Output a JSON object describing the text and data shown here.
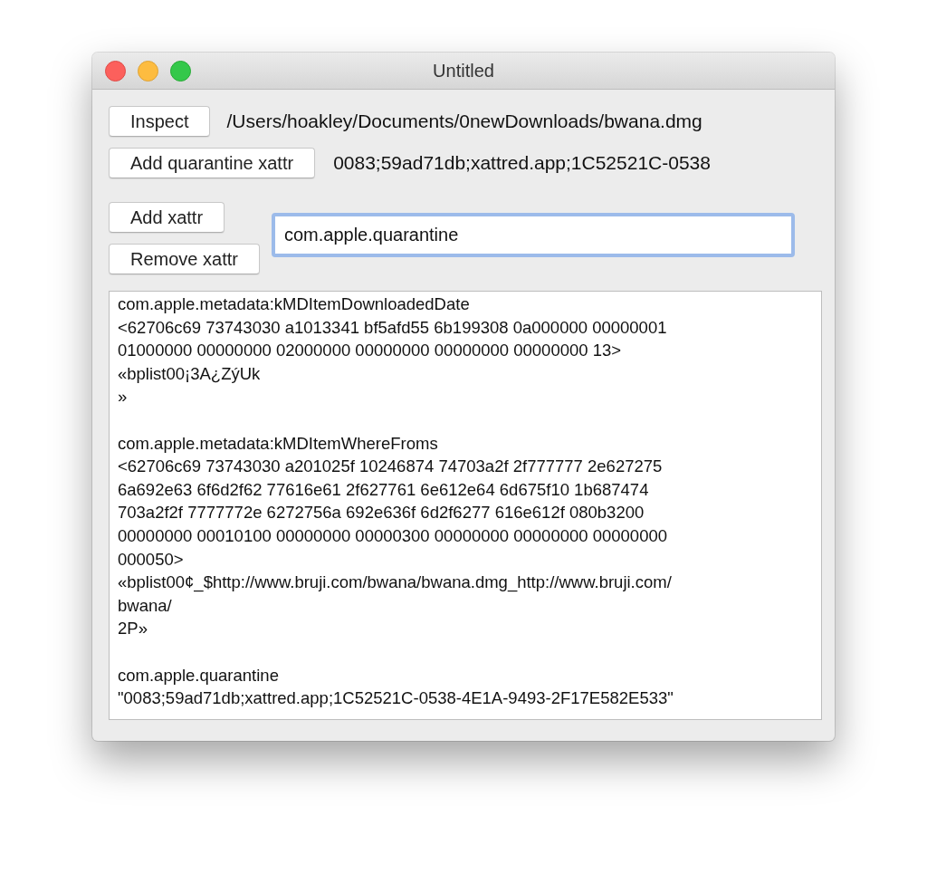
{
  "window": {
    "title": "Untitled"
  },
  "inspect": {
    "button": "Inspect",
    "path": "/Users/hoakley/Documents/0newDownloads/bwana.dmg"
  },
  "quarantine": {
    "button": "Add quarantine xattr",
    "value": "0083;59ad71db;xattred.app;1C52521C-0538"
  },
  "xattr_buttons": [
    "Add xattr",
    "Remove xattr"
  ],
  "name_field": {
    "value": "com.apple.quarantine",
    "focused": true
  },
  "output": {
    "blocks": [
      {
        "lines": [
          "com.apple.metadata:kMDItemDownloadedDate",
          "<62706c69 73743030 a1013341 bf5afd55 6b199308 0a000000 00000001",
          "01000000 00000000 02000000 00000000 00000000 00000000 13>",
          "«bplist00¡3A¿ZýUk",
          "»"
        ]
      },
      {
        "lines": [
          "com.apple.metadata:kMDItemWhereFroms",
          "<62706c69 73743030 a201025f 10246874 74703a2f 2f777777 2e627275",
          "6a692e63 6f6d2f62 77616e61 2f627761 6e612e64 6d675f10 1b687474",
          "703a2f2f 7777772e 6272756a 692e636f 6d2f6277 616e612f 080b3200",
          "00000000 00010100 00000000 00000300 00000000 00000000 00000000",
          "000050>",
          "«bplist00¢_$http://www.bruji.com/bwana/bwana.dmg_http://www.bruji.com/",
          "bwana/",
          "2P»"
        ]
      },
      {
        "lines": [
          "com.apple.quarantine",
          "\"0083;59ad71db;xattred.app;1C52521C-0538-4E1A-9493-2F17E582E533\""
        ]
      }
    ]
  }
}
